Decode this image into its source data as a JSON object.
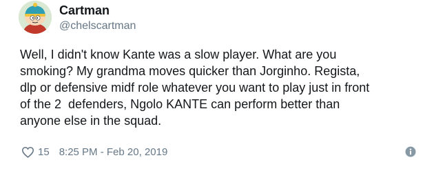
{
  "tweet": {
    "author": {
      "display_name": "Cartman",
      "handle": "@chelscartman",
      "avatar_icon": "cartoon-character-avatar"
    },
    "text_lines": [
      "Well, I didn't know Kante was a slow player. What are you",
      "smoking? My grandma moves quicker than Jorginho. Regista,",
      "dlp or defensive midf role whatever you want to play just in front",
      "of the 2  defenders, Ngolo KANTE can perform better than",
      "anyone else in the squad."
    ],
    "likes": "15",
    "timestamp": "8:25 PM - Feb 20, 2019",
    "icons": {
      "like": "heart-icon",
      "info": "info-icon"
    },
    "colors": {
      "text": "#14171a",
      "secondary": "#657786"
    }
  }
}
